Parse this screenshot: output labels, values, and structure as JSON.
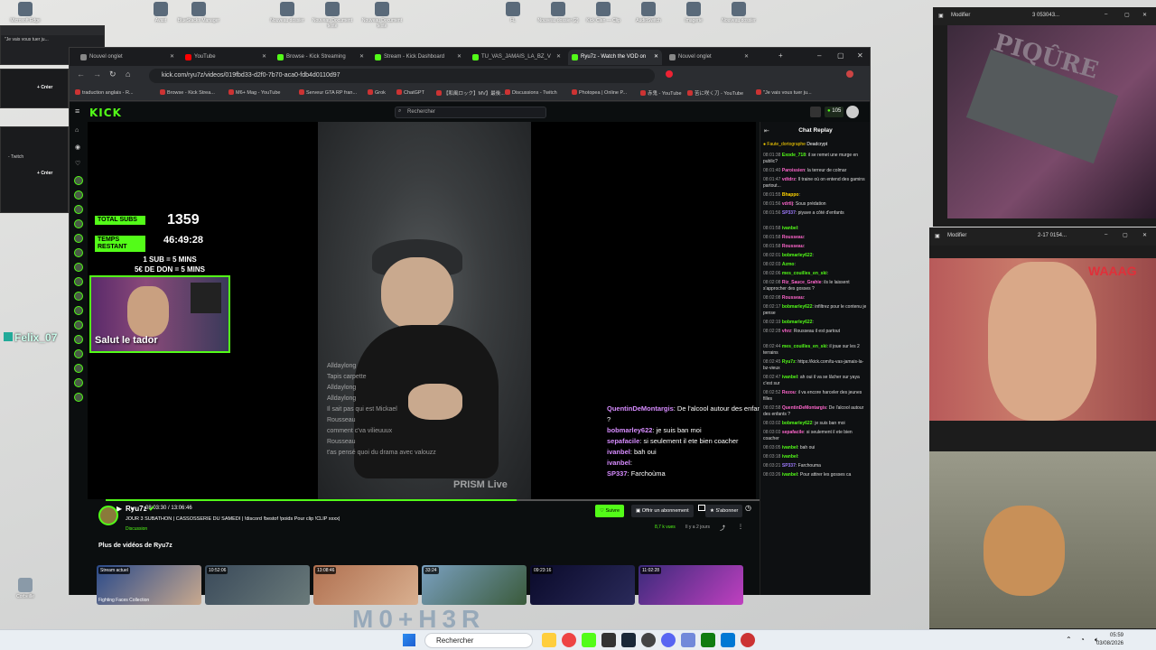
{
  "desktop": {
    "icons": [
      {
        "label": "Microsoft Edge",
        "x": 0
      },
      {
        "label": "Avast",
        "x": 1
      },
      {
        "label": "BlueStacks Manager",
        "x": 2
      },
      {
        "label": "Nouveau dossier",
        "x": 3
      },
      {
        "label": "Nouveau Document texte",
        "x": 4
      },
      {
        "label": "Nouveau Document texte",
        "x": 5
      },
      {
        "label": "FL",
        "x": 6
      },
      {
        "label": "Nouveau dossier (2)",
        "x": 7
      },
      {
        "label": "Kick Clan — Clip",
        "x": 8
      },
      {
        "label": "AudioSwitch",
        "x": 9
      },
      {
        "label": "Imagerie",
        "x": 10
      },
      {
        "label": "Nouveau dossier",
        "x": 11
      }
    ],
    "recycle_label": "Corbeille",
    "felix_label": "Felix_07"
  },
  "taskbar": {
    "search_placeholder": "Rechercher",
    "time": "05:59",
    "date": "03/08/2026"
  },
  "bg_windows": {
    "w1_text": "\"Je vais vous tuer ju...",
    "create_label": "Créer",
    "twitch_label": "- Twitch",
    "create_label2": "Créer"
  },
  "browser": {
    "tabs": [
      {
        "label": "Nouvel onglet",
        "color": "#888888"
      },
      {
        "label": "YouTube",
        "color": "#ff0000"
      },
      {
        "label": "Browse - Kick Streaming",
        "color": "#53fc18"
      },
      {
        "label": "Stream - Kick Dashboard",
        "color": "#53fc18"
      },
      {
        "label": "TU_VAS_JAMAIS_LA_BZ_V",
        "color": "#53fc18"
      },
      {
        "label": "Ryu7z - Watch the VOD on",
        "color": "#53fc18"
      },
      {
        "label": "Nouvel onglet",
        "color": "#888888"
      }
    ],
    "url": "kick.com/ryu7z/videos/019fbd33-d2f0-7b70-aca0-fdb4d0110d97",
    "bookmarks": [
      "traduction anglais - R...",
      "Browse - Kick Strea...",
      "M6+ Mag - YouTube",
      "Serveur GTA RP fran...",
      "Grok",
      "ChatGPT",
      "【和風ロック】MV】最後...",
      "Discussions - Twitch",
      "Photopea | Online P...",
      "赤鬼 - YouTube",
      "苦に咲く刀 - YouTube",
      "\"Je vais vous tuer ju..."
    ]
  },
  "kick": {
    "logo": "KICK",
    "search_placeholder": "Rechercher",
    "viewer_count": "105",
    "overlay": {
      "total_subs_label": "TOTAL SUBS",
      "total_subs_value": "1359",
      "time_label": "TEMPS RESTANT",
      "time_value": "46:49:28",
      "rule1": "1 SUB = 5 MINS",
      "rule2": "5€ DE DON = 5 MINS",
      "cam_text": "Salut le tador",
      "faint_chat": [
        {
          "user": "Alldaylong",
          "msg": "Tapis carpette"
        },
        {
          "user": "Alldaylong",
          "msg": ""
        },
        {
          "user": "Alldaylong",
          "msg": "Il sait pas qui est Mickael"
        },
        {
          "user": "Rousseau",
          "msg": "comment c'va vilieuuux"
        },
        {
          "user": "Rousseau",
          "msg": "t'as pensé quoi du drama avec valouzz"
        }
      ],
      "prism": "PRISM Live"
    },
    "video_chat": [
      {
        "user": "QuentinDeMontargis",
        "msg": ": De l'alcool autour des enfants ?"
      },
      {
        "user": "bobmarley622",
        "msg": ": je suis ban moi"
      },
      {
        "user": "sepafacile",
        "msg": ": si seulement il ete bien coacher"
      },
      {
        "user": "ivanbel",
        "msg": ": bah oui"
      },
      {
        "user": "ivanbel",
        "msg": ":"
      },
      {
        "user": "SP337",
        "msg": ": Farchoùma"
      }
    ],
    "player": {
      "time": "08:03:30 / 13:06:46",
      "progress": 0.615
    },
    "channel": {
      "name": "Ryu7z",
      "title": "JOUR 3 SUBATHON | CASSOSSERIE DU SAMEDI | !discord !bestof !poids Pour clip !CLIP xxxx|",
      "category": "Discussion",
      "views": "8,7 k vues",
      "ago": "Il y a 2 jours",
      "follow_label": "Suivre",
      "gift_label": "Offrir un abonnement",
      "sub_label": "S'abonner"
    },
    "more_videos_title": "Plus de vidéos de Ryu7z",
    "thumbs": [
      {
        "badge": "Stream actuel",
        "caption": "Fighting Faces Collection"
      },
      {
        "badge": "10:52:06",
        "caption": ""
      },
      {
        "badge": "13:08:46",
        "caption": ""
      },
      {
        "badge": "33:24",
        "caption": ""
      },
      {
        "badge": "09:23:16",
        "caption": ""
      },
      {
        "badge": "11:02:28",
        "caption": ""
      }
    ],
    "chat": {
      "title": "Chat Replay",
      "pinned": "Faute_dortographe",
      "pinned2": "Deadcrypt",
      "messages": [
        {
          "t": "08:01:38",
          "u": "Exode_718",
          "c": "#53fc18",
          "m": ": il se remet une murge en public?"
        },
        {
          "t": "08:01:40",
          "u": "Paroissien",
          "c": "#ff66cc",
          "m": ": la terreur de colmar"
        },
        {
          "t": "08:01:47",
          "u": "vdtdrz",
          "c": "#ff66cc",
          "m": ": Il traine où on entend des gamins partout..."
        },
        {
          "t": "08:01:55",
          "u": "Bhappo",
          "c": "#ffd400",
          "m": ":"
        },
        {
          "t": "08:01:56",
          "u": "vdrtlj",
          "c": "#ff66cc",
          "m": ": Sous prédation"
        },
        {
          "t": "08:01:56",
          "u": "SP337",
          "c": "#9f7bff",
          "m": ": piyave a côté d'enfants"
        },
        {
          "t": "08:01:58",
          "u": "ivanbel",
          "c": "#53fc18",
          "m": ":"
        },
        {
          "t": "08:01:58",
          "u": "Rousseau",
          "c": "#ff66cc",
          "m": ":"
        },
        {
          "t": "08:01:58",
          "u": "Rousseau",
          "c": "#ff66cc",
          "m": ":"
        },
        {
          "t": "08:02:01",
          "u": "bobmarley622",
          "c": "#53fc18",
          "m": ":"
        },
        {
          "t": "08:02:03",
          "u": "Azmo",
          "c": "#53fc18",
          "m": ":"
        },
        {
          "t": "08:02:06",
          "u": "mes_couilles_en_ski",
          "c": "#53fc18",
          "m": ":"
        },
        {
          "t": "08:02:08",
          "u": "Riz_Sauce_Grahie",
          "c": "#ff66cc",
          "m": ": ils le laissent s'approcher des gosses ?"
        },
        {
          "t": "08:02:08",
          "u": "Rousseau",
          "c": "#ff66cc",
          "m": ":"
        },
        {
          "t": "08:02:17",
          "u": "bobmarley622",
          "c": "#53fc18",
          "m": ": infiltrez pour le contenu je pense"
        },
        {
          "t": "08:02:19",
          "u": "bobmarley622",
          "c": "#53fc18",
          "m": ":"
        },
        {
          "t": "08:02:28",
          "u": "vhrz",
          "c": "#ff66cc",
          "m": ": Rousseau il est partout"
        },
        {
          "t": "08:02:44",
          "u": "mes_couilles_en_ski",
          "c": "#53fc18",
          "m": ": il joue sur les 2 terrains"
        },
        {
          "t": "08:02:45",
          "u": "Ryu7z",
          "c": "#53fc18",
          "m": ": https://kick.com/tu-vas-jamais-la-bz-vieux"
        },
        {
          "t": "08:02:47",
          "u": "ivanbel",
          "c": "#53fc18",
          "m": ": ah oui il va se lâcher sur yaya c'est sur"
        },
        {
          "t": "08:02:52",
          "u": "Rezou",
          "c": "#ff66cc",
          "m": ": il va encore harceler des jeunes filles"
        },
        {
          "t": "08:02:58",
          "u": "QuentinDeMontargis",
          "c": "#ff66cc",
          "m": ": De l'alcool autour des enfants ?"
        },
        {
          "t": "08:03:02",
          "u": "bobmarley622",
          "c": "#53fc18",
          "m": ": je suis ban moi"
        },
        {
          "t": "08:03:03",
          "u": "sepafacile",
          "c": "#ff66cc",
          "m": ": si seulement il ete bien coacher"
        },
        {
          "t": "08:03:05",
          "u": "ivanbel",
          "c": "#53fc18",
          "m": ": bah oui"
        },
        {
          "t": "08:03:18",
          "u": "ivanbel",
          "c": "#53fc18",
          "m": ":"
        },
        {
          "t": "08:03:21",
          "u": "SP337",
          "c": "#9f7bff",
          "m": ": Farchouma"
        },
        {
          "t": "08:03:26",
          "u": "ivanbel",
          "c": "#53fc18",
          "m": ": Pour attirer les gosses ca"
        }
      ]
    }
  },
  "side_windows": {
    "w1_title": "Modifier",
    "w1_size": "3 053043...",
    "w1_sign": "PIQÛRE",
    "w2_title": "Modifier",
    "w2_size": "2-17 0154...",
    "w2_sign": "WAAAG"
  }
}
